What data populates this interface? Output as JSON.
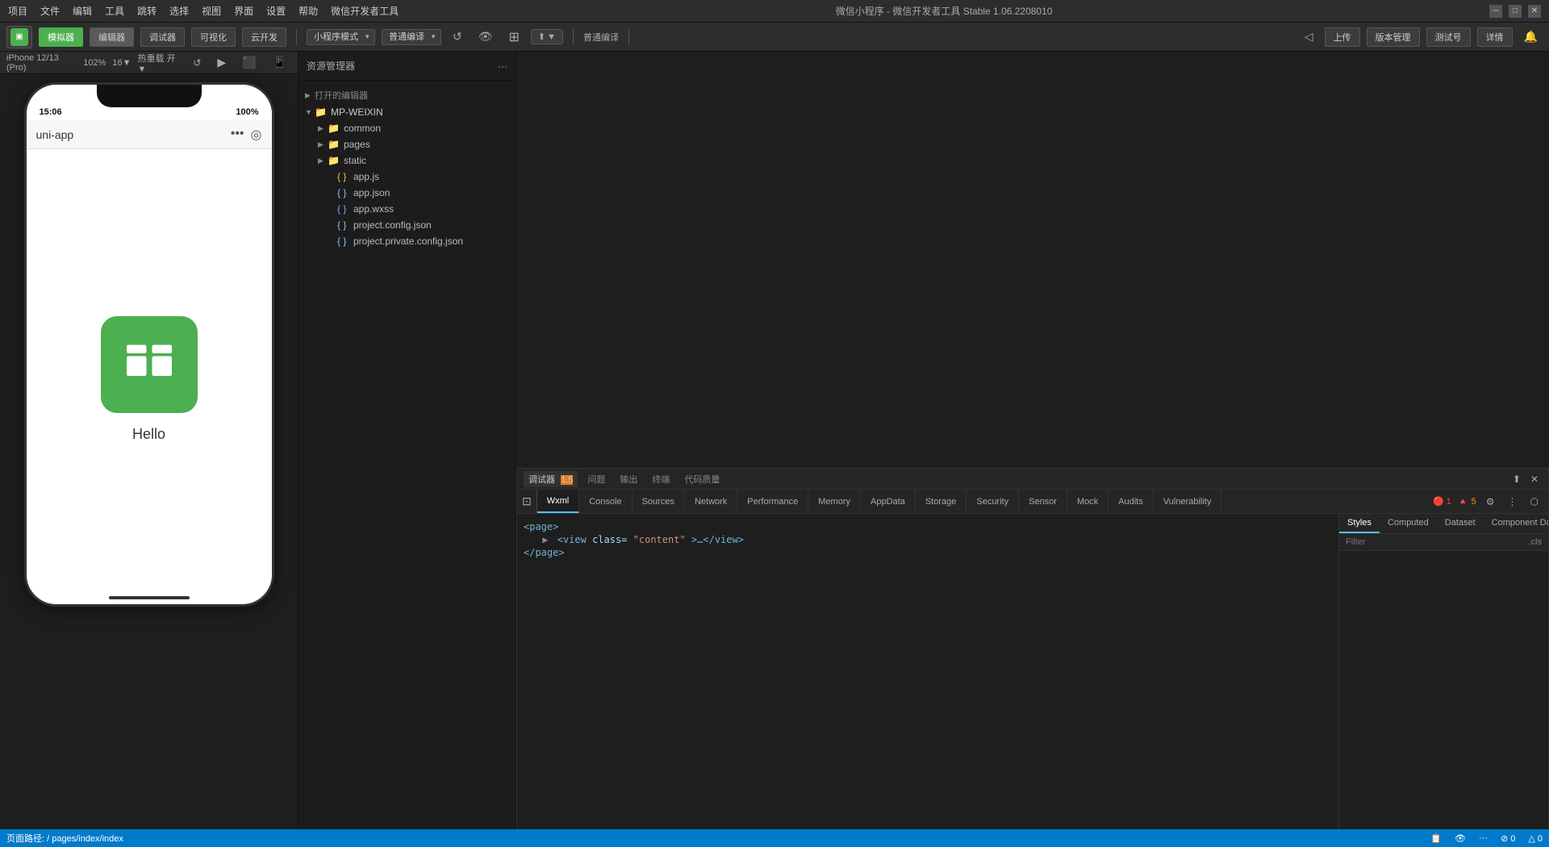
{
  "window": {
    "title": "微信小程序 - 微信开发者工具 Stable 1.06.2208010",
    "minimize_label": "─",
    "maximize_label": "□",
    "close_label": "✕"
  },
  "menu": {
    "items": [
      "项目",
      "文件",
      "编辑",
      "工具",
      "跳转",
      "选择",
      "视图",
      "界面",
      "设置",
      "帮助",
      "微信开发者工具"
    ]
  },
  "toolbar": {
    "sim_label": "模拟器",
    "editor_label": "编辑器",
    "debug_label": "调试器",
    "visual_label": "可视化",
    "cloud_label": "云开发",
    "mode_select": "小程序模式",
    "compile_select": "普通编译",
    "refresh_label": "↺",
    "preview_label": "预览",
    "real_machine_label": "真机调试",
    "clear_cache_label": "清缓存",
    "upload_label": "上传",
    "version_mgr_label": "版本管理",
    "test_label": "测试号",
    "detail_label": "详情",
    "message_label": "消息"
  },
  "simulator_bar": {
    "device": "iPhone 12/13 (Pro)",
    "zoom": "102%",
    "rotate": "16▼",
    "screenshot": "热重载 开▼"
  },
  "phone": {
    "time": "15:06",
    "battery": "100%",
    "app_title": "uni-app",
    "hello_text": "Hello"
  },
  "explorer": {
    "title": "资源管理器",
    "more_label": "···",
    "sections": {
      "opened_editors": "打开的编辑器",
      "project": "MP-WEIXIN"
    },
    "items": [
      {
        "label": "common",
        "type": "folder",
        "indent": 2
      },
      {
        "label": "pages",
        "type": "folder",
        "indent": 2
      },
      {
        "label": "static",
        "type": "folder",
        "indent": 2
      },
      {
        "label": "app.js",
        "type": "js",
        "indent": 3
      },
      {
        "label": "app.json",
        "type": "json",
        "indent": 3
      },
      {
        "label": "app.wxss",
        "type": "wxss",
        "indent": 3
      },
      {
        "label": "project.config.json",
        "type": "json",
        "indent": 3
      },
      {
        "label": "project.private.config.json",
        "type": "json",
        "indent": 3
      }
    ]
  },
  "devtools": {
    "tabs": [
      {
        "label": "调试器",
        "badge": "1.5",
        "active": false
      },
      {
        "label": "问题",
        "active": false
      },
      {
        "label": "输出",
        "active": false
      },
      {
        "label": "终端",
        "active": false
      },
      {
        "label": "代码质量",
        "active": false
      }
    ],
    "main_tabs": [
      {
        "label": "Wxml",
        "active": true
      },
      {
        "label": "Console",
        "active": false
      },
      {
        "label": "Sources",
        "active": false
      },
      {
        "label": "Network",
        "active": false
      },
      {
        "label": "Performance",
        "active": false
      },
      {
        "label": "Memory",
        "active": false
      },
      {
        "label": "AppData",
        "active": false
      },
      {
        "label": "Storage",
        "active": false
      },
      {
        "label": "Security",
        "active": false
      },
      {
        "label": "Sensor",
        "active": false
      },
      {
        "label": "Mock",
        "active": false
      },
      {
        "label": "Audits",
        "active": false
      },
      {
        "label": "Vulnerability",
        "active": false
      }
    ],
    "error_badge": "1",
    "warn_badge": "5",
    "xml_content": [
      {
        "text": "<page>",
        "indent": 0
      },
      {
        "text": "<view class=\"content\">…</view>",
        "indent": 1
      },
      {
        "text": "</page>",
        "indent": 0
      }
    ],
    "right_tabs": [
      "Styles",
      "Computed",
      "Dataset",
      "Component Data"
    ],
    "active_right_tab": "Styles",
    "filter_placeholder": "Filter",
    "filter_cls": ".cls"
  },
  "status_bar": {
    "path": "页面路径: / pages/index/index",
    "copy_icon": "📋",
    "eye_icon": "👁",
    "more_icon": "···",
    "errors": "⊘ 0",
    "warnings": "△ 0"
  }
}
